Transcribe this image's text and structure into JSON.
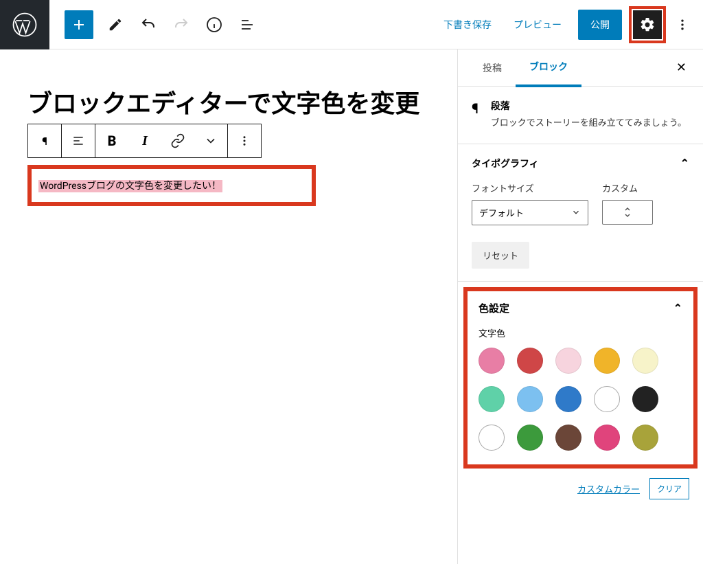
{
  "toolbar": {
    "save_draft": "下書き保存",
    "preview": "プレビュー",
    "publish": "公開"
  },
  "editor": {
    "title": "ブロックエディターで文字色を変更",
    "paragraph_text": "WordPressブログの文字色を変更したい！"
  },
  "sidebar": {
    "tabs": {
      "post": "投稿",
      "block": "ブロック"
    },
    "block_info": {
      "title": "段落",
      "description": "ブロックでストーリーを組み立ててみましょう。"
    },
    "typography": {
      "heading": "タイポグラフィ",
      "font_size_label": "フォントサイズ",
      "custom_label": "カスタム",
      "font_size_value": "デフォルト",
      "reset": "リセット"
    },
    "color": {
      "heading": "色設定",
      "text_color_label": "文字色",
      "custom_color": "カスタムカラー",
      "clear": "クリア",
      "swatches": [
        "#e87ea5",
        "#cf4647",
        "#f7d4de",
        "#f0b429",
        "#f7f3c9",
        "#5fd1a8",
        "#7cc0f0",
        "#2f7ac9",
        "#ffffff",
        "#222222",
        "#ffffff",
        "#3c9a3c",
        "#6b4638",
        "#e0447c",
        "#a8a33a"
      ]
    }
  }
}
